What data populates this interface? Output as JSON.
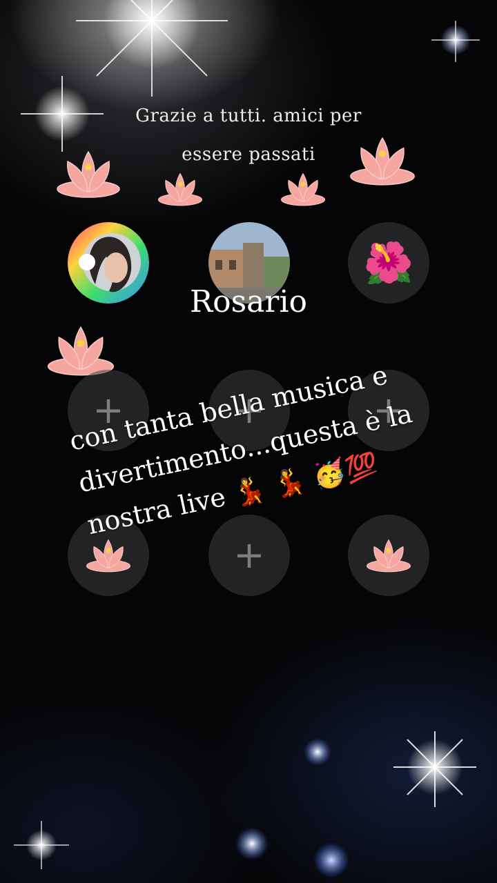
{
  "story": {
    "header_line1": "Grazie a tutti.  amici per",
    "header_line2": "essere  passati",
    "username": "Rosario",
    "caption_line1": "con tanta bella musica e",
    "caption_line2": "divertimento...questa  è la",
    "caption_line3": "nostra live",
    "caption_emojis": "💃 💃 🥳💯",
    "hibiscus_emoji": "🌺"
  },
  "grid": {
    "plus_symbol": "+"
  },
  "icons": [
    "lotus-icon",
    "hibiscus-icon",
    "plus-icon",
    "sparkle-icon"
  ],
  "colors": {
    "background": "#050507",
    "lotus_petal": "#f6a6a0",
    "slot": "#3c3c40",
    "text": "#ffffff"
  }
}
